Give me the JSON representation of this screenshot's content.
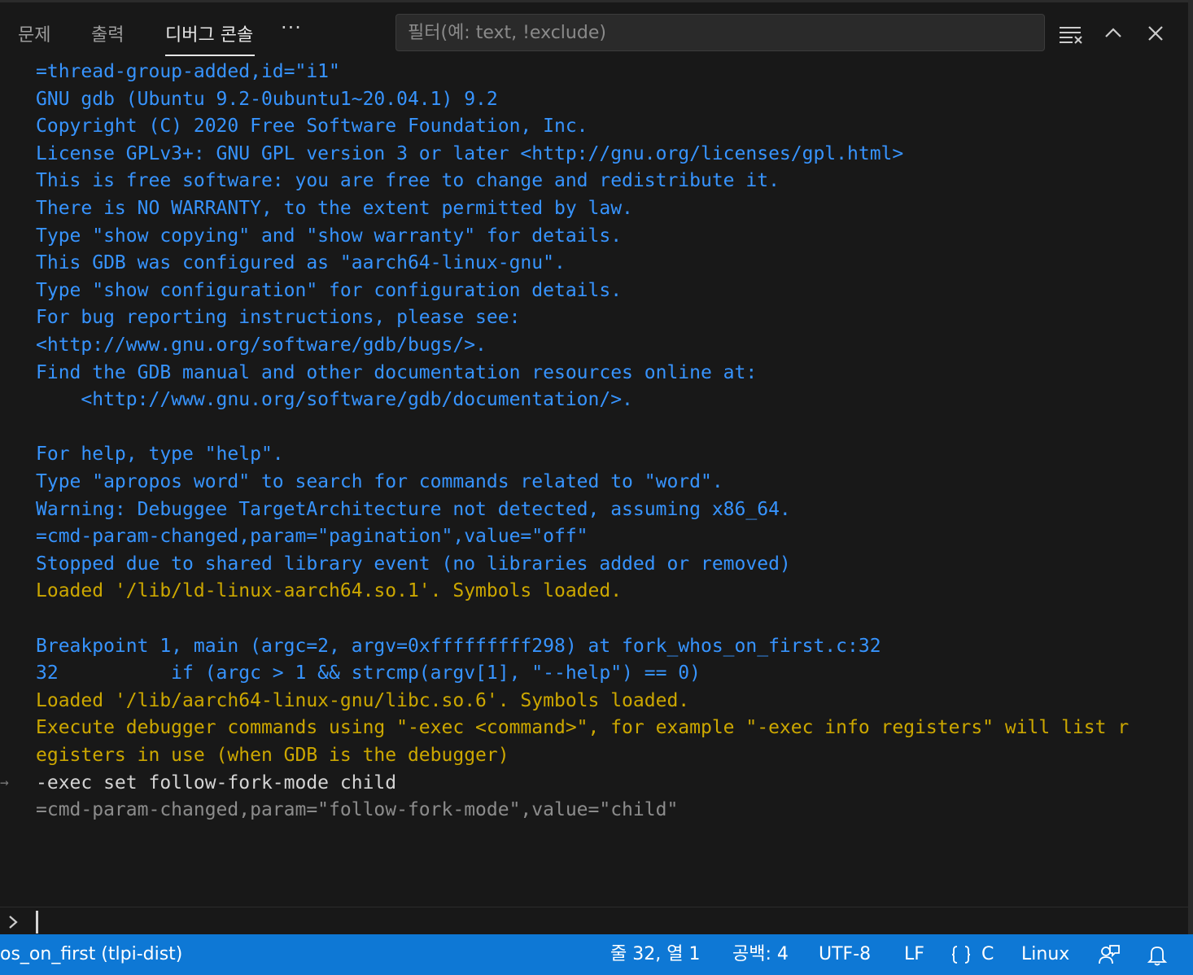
{
  "panel": {
    "tabs": [
      {
        "label": "문제"
      },
      {
        "label": "출력"
      },
      {
        "label": "디버그 콘솔"
      }
    ],
    "more_label": "···",
    "filter_placeholder": "필터(예: text, !exclude)",
    "icons": [
      "clear-console-icon",
      "chevron-up-icon",
      "close-icon"
    ]
  },
  "console": {
    "lines": [
      {
        "text": "=thread-group-added,id=\"i1\"",
        "color": "blue"
      },
      {
        "text": "GNU gdb (Ubuntu 9.2-0ubuntu1~20.04.1) 9.2",
        "color": "blue"
      },
      {
        "text": "Copyright (C) 2020 Free Software Foundation, Inc.",
        "color": "blue"
      },
      {
        "text": "License GPLv3+: GNU GPL version 3 or later <http://gnu.org/licenses/gpl.html>",
        "color": "blue"
      },
      {
        "text": "This is free software: you are free to change and redistribute it.",
        "color": "blue"
      },
      {
        "text": "There is NO WARRANTY, to the extent permitted by law.",
        "color": "blue"
      },
      {
        "text": "Type \"show copying\" and \"show warranty\" for details.",
        "color": "blue"
      },
      {
        "text": "This GDB was configured as \"aarch64-linux-gnu\".",
        "color": "blue"
      },
      {
        "text": "Type \"show configuration\" for configuration details.",
        "color": "blue"
      },
      {
        "text": "For bug reporting instructions, please see:",
        "color": "blue"
      },
      {
        "text": "<http://www.gnu.org/software/gdb/bugs/>.",
        "color": "blue"
      },
      {
        "text": "Find the GDB manual and other documentation resources online at:",
        "color": "blue"
      },
      {
        "text": "    <http://www.gnu.org/software/gdb/documentation/>.",
        "color": "blue"
      },
      {
        "text": "",
        "color": "blue"
      },
      {
        "text": "For help, type \"help\".",
        "color": "blue"
      },
      {
        "text": "Type \"apropos word\" to search for commands related to \"word\".",
        "color": "blue"
      },
      {
        "text": "Warning: Debuggee TargetArchitecture not detected, assuming x86_64.",
        "color": "blue"
      },
      {
        "text": "=cmd-param-changed,param=\"pagination\",value=\"off\"",
        "color": "blue"
      },
      {
        "text": "Stopped due to shared library event (no libraries added or removed)",
        "color": "blue"
      },
      {
        "text": "Loaded '/lib/ld-linux-aarch64.so.1'. Symbols loaded.",
        "color": "yellow"
      },
      {
        "text": "",
        "color": "blue"
      },
      {
        "text": "Breakpoint 1, main (argc=2, argv=0xfffffffff298) at fork_whos_on_first.c:32",
        "color": "blue"
      },
      {
        "text": "32          if (argc > 1 && strcmp(argv[1], \"--help\") == 0)",
        "color": "blue"
      },
      {
        "text": "Loaded '/lib/aarch64-linux-gnu/libc.so.6'. Symbols loaded.",
        "color": "yellow"
      },
      {
        "text": "Execute debugger commands using \"-exec <command>\", for example \"-exec info registers\" will list r",
        "color": "yellow"
      },
      {
        "text": "egisters in use (when GDB is the debugger)",
        "color": "yellow"
      },
      {
        "text": "-exec set follow-fork-mode child",
        "color": "white",
        "input": true
      },
      {
        "text": "=cmd-param-changed,param=\"follow-fork-mode\",value=\"child\"",
        "color": "gray"
      }
    ],
    "input_marker": "→",
    "input_value": ""
  },
  "statusbar": {
    "left_label": "os_on_first (tlpi-dist)",
    "position": "줄 32, 열 1",
    "indent": "공백: 4",
    "encoding": "UTF-8",
    "eol": "LF",
    "language": "C",
    "platform": "Linux",
    "background": "#0e78d5"
  }
}
